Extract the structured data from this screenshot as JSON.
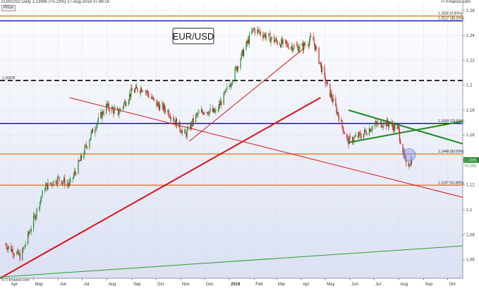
{
  "header": {
    "instrument_info": "EUR/USD  Daily  1.13995 (+0.23%)  17-Aug-2018 07:48:16",
    "site": "IT-Finance.com",
    "price_label": "Price"
  },
  "copyright": "© IT-Finance.com",
  "chart_data": {
    "type": "candlestick",
    "title": "EUR/USD",
    "y_range": [
      1.045,
      1.265
    ],
    "x_range": [
      "2017-03-20",
      "2018-10-20"
    ],
    "y_ticks": [
      "1.26",
      "1.24",
      "1.22",
      "1.2",
      "1.18",
      "1.16",
      "1.14",
      "1.12",
      "1.1",
      "1.08",
      "1.06"
    ],
    "x_ticks": [
      "Apr",
      "May",
      "Jun",
      "Jul",
      "Aug",
      "Sep",
      "Oct",
      "Nov",
      "Dec",
      "2018",
      "Feb",
      "Mar",
      "Apr",
      "May",
      "Jun",
      "Jul",
      "Aug",
      "Sep",
      "Oct"
    ],
    "grid": true,
    "current_price": {
      "value": 1.13995,
      "label": "1.13995",
      "change": "+0.23%"
    },
    "series": [
      {
        "x": [
          "2017-03-27",
          "2017-04-15",
          "2017-05-01",
          "2017-05-15",
          "2017-06-01",
          "2017-06-15",
          "2017-06-30",
          "2017-07-15",
          "2017-07-31",
          "2017-08-15",
          "2017-09-01",
          "2017-09-15",
          "2017-10-01",
          "2017-10-15",
          "2017-11-07",
          "2017-11-20",
          "2017-12-01",
          "2017-12-15",
          "2018-01-01",
          "2018-01-15",
          "2018-01-31",
          "2018-02-15",
          "2018-03-01",
          "2018-03-15",
          "2018-04-01",
          "2018-04-15",
          "2018-04-30",
          "2018-05-15",
          "2018-05-29",
          "2018-06-15",
          "2018-07-01",
          "2018-07-15",
          "2018-07-31",
          "2018-08-10",
          "2018-08-17"
        ],
        "y": [
          1.072,
          1.062,
          1.092,
          1.118,
          1.125,
          1.12,
          1.142,
          1.165,
          1.183,
          1.178,
          1.195,
          1.198,
          1.185,
          1.18,
          1.16,
          1.175,
          1.18,
          1.178,
          1.2,
          1.222,
          1.245,
          1.24,
          1.235,
          1.232,
          1.23,
          1.238,
          1.205,
          1.18,
          1.155,
          1.16,
          1.168,
          1.17,
          1.165,
          1.135,
          1.14
        ]
      }
    ],
    "horizontal_levels": [
      {
        "value": 1.2556,
        "label": "1.2556 (0.00%)",
        "color": "#e8813a",
        "style": "solid"
      },
      {
        "value": 1.2517,
        "label": "1.2517 (38.20%)",
        "color": "#1a1aa8",
        "style": "solid"
      },
      {
        "value": 1.20378,
        "label": "1.20378",
        "color": "#000000",
        "style": "dashed"
      },
      {
        "value": 1.1693,
        "label": "1.1693 (23.60%)",
        "color": "#1a1aa8",
        "style": "solid"
      },
      {
        "value": 1.1448,
        "label": "1.1448 (50.00%)",
        "color": "#e8813a",
        "style": "solid"
      },
      {
        "value": 1.1197,
        "label": "1.1197 (61.80%)",
        "color": "#e8813a",
        "style": "solid"
      }
    ],
    "trend_lines": [
      {
        "from": [
          "2017-03-20",
          1.045
        ],
        "to": [
          "2018-04-25",
          1.19
        ],
        "color": "#dd1111",
        "width": 2
      },
      {
        "from": [
          "2017-06-15",
          1.19
        ],
        "to": [
          "2018-10-20",
          1.11
        ],
        "color": "#dd1111",
        "width": 1
      },
      {
        "from": [
          "2017-11-12",
          1.155
        ],
        "to": [
          "2018-04-05",
          1.23
        ],
        "color": "#dd1111",
        "width": 1
      },
      {
        "from": [
          "2017-03-20",
          1.046
        ],
        "to": [
          "2018-10-20",
          1.071
        ],
        "color": "#2ca02c",
        "width": 1
      },
      {
        "from": [
          "2018-05-30",
          1.18
        ],
        "to": [
          "2018-10-20",
          1.153
        ],
        "color": "#1a8a1a",
        "width": 2
      },
      {
        "from": [
          "2018-05-30",
          1.154
        ],
        "to": [
          "2018-10-20",
          1.171
        ],
        "color": "#1a8a1a",
        "width": 2
      }
    ],
    "colors": {
      "up": "#1f8a2a",
      "down": "#d02020",
      "background_top": "#ffffff",
      "background_bottom": "#dbe1f4"
    }
  }
}
